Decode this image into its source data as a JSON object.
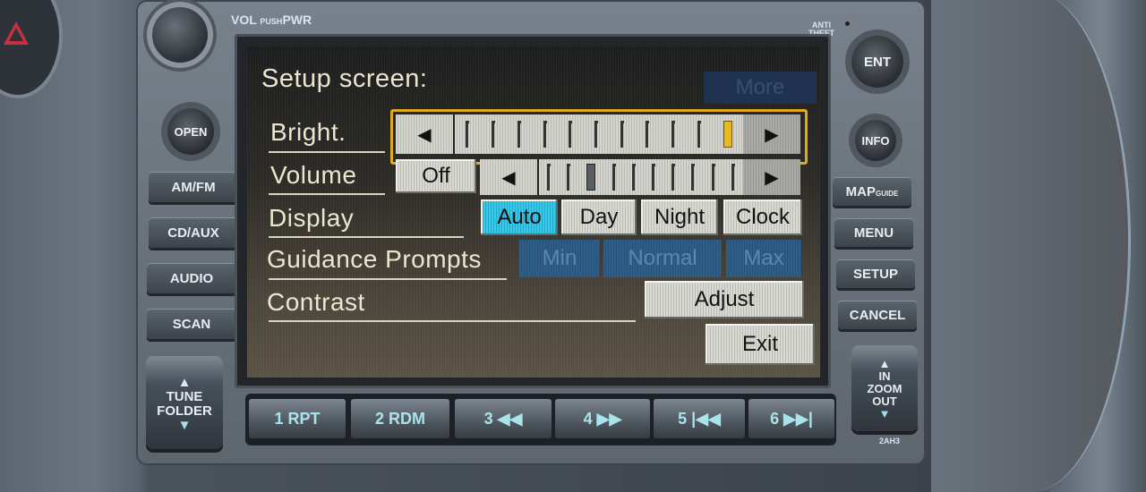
{
  "device": {
    "silkscreen_vol": "VOL",
    "silkscreen_push": "PUSH",
    "silkscreen_pwr": "PWR",
    "anti_theft_1": "ANTI",
    "anti_theft_2": "THEFT",
    "model_code": "2AH3",
    "left_buttons": [
      {
        "label": "OPEN",
        "icon": "open-eject"
      },
      {
        "label": "AM/FM"
      },
      {
        "label": "CD/AUX"
      },
      {
        "label": "AUDIO"
      },
      {
        "label": "SCAN"
      }
    ],
    "tune_folder": {
      "line1": "TUNE",
      "line2": "FOLDER",
      "up": "▲",
      "down": "▼"
    },
    "right_buttons": [
      {
        "label": "ENT"
      },
      {
        "label": "INFO"
      },
      {
        "label": "MAP",
        "sub": "GUIDE"
      },
      {
        "label": "MENU"
      },
      {
        "label": "SETUP"
      },
      {
        "label": "CANCEL"
      }
    ],
    "zoom": {
      "up": "▲",
      "line1": "IN",
      "line2": "ZOOM",
      "line3": "OUT",
      "down": "▼"
    },
    "presets": [
      {
        "label": "1 RPT"
      },
      {
        "label": "2 RDM"
      },
      {
        "label": "3 ◀◀"
      },
      {
        "label": "4 ▶▶"
      },
      {
        "label": "5 |◀◀"
      },
      {
        "label": "6 ▶▶|"
      }
    ]
  },
  "screen": {
    "title": "Setup screen:",
    "more_label": "More",
    "bright": {
      "label": "Bright.",
      "left": "◀",
      "right": "▶",
      "level": 11,
      "max": 11
    },
    "volume": {
      "label": "Volume",
      "off_label": "Off",
      "left": "◀",
      "right": "▶",
      "level": 3,
      "max": 10
    },
    "display": {
      "label": "Display",
      "options": [
        "Auto",
        "Day",
        "Night",
        "Clock"
      ],
      "selected": "Auto"
    },
    "guidance": {
      "label": "Guidance Prompts",
      "options": [
        "Min",
        "Normal",
        "Max"
      ],
      "state": "disabled"
    },
    "contrast": {
      "label": "Contrast",
      "adjust_label": "Adjust"
    },
    "exit_label": "Exit",
    "colors": {
      "focus": "#e0aa20",
      "selected": "#2bb8dc",
      "disabled": "#2c5880"
    }
  }
}
